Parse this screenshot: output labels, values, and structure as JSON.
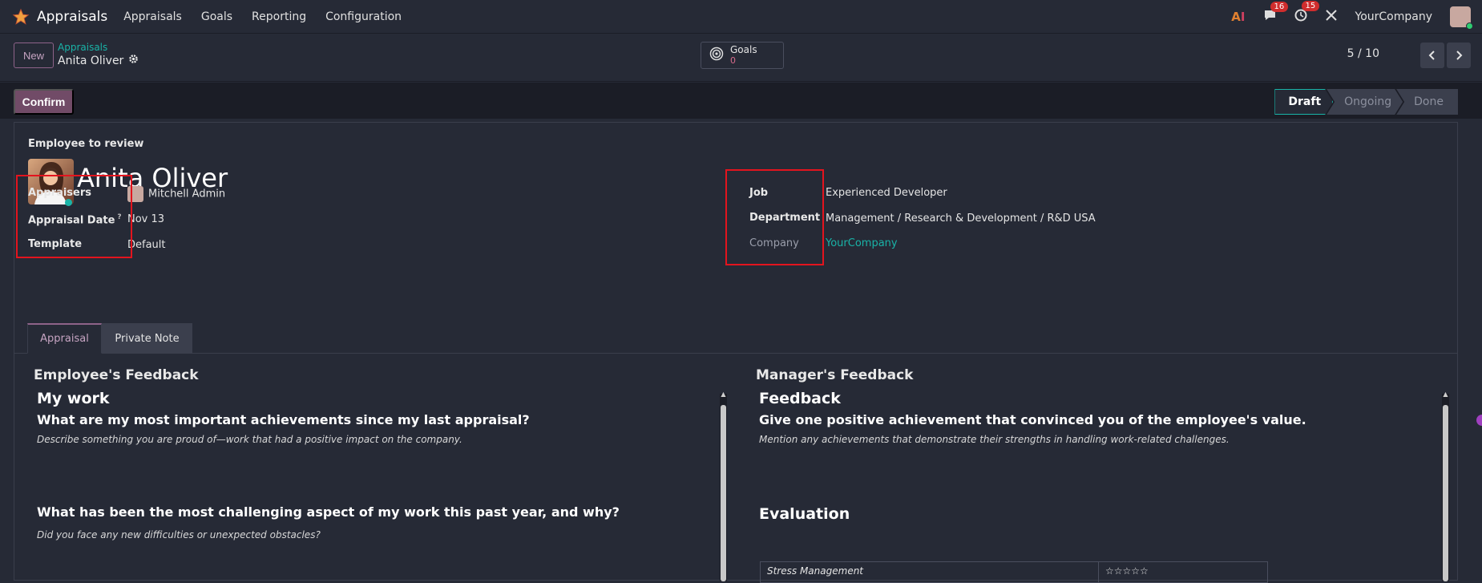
{
  "app": {
    "name": "Appraisals",
    "menu": [
      "Appraisals",
      "Goals",
      "Reporting",
      "Configuration"
    ]
  },
  "systray": {
    "messages_count": "16",
    "activities_count": "15",
    "company": "YourCompany"
  },
  "control": {
    "new_label": "New",
    "breadcrumb_parent": "Appraisals",
    "breadcrumb_current": "Anita Oliver",
    "goals_label": "Goals",
    "goals_count": "0",
    "pager": "5 / 10"
  },
  "status": {
    "confirm_label": "Confirm",
    "stages": [
      "Draft",
      "Ongoing",
      "Done"
    ],
    "active_stage": "Draft"
  },
  "employee": {
    "section_label": "Employee to review",
    "name": "Anita Oliver"
  },
  "fields_left": {
    "appraisers_label": "Appraisers",
    "appraisers_value": "Mitchell Admin",
    "date_label": "Appraisal Date",
    "date_help": "?",
    "date_value": "Nov 13",
    "template_label": "Template",
    "template_value": "Default"
  },
  "fields_right": {
    "job_label": "Job",
    "job_value": "Experienced Developer",
    "department_label": "Department",
    "department_value": "Management / Research & Development / R&D USA",
    "company_label": "Company",
    "company_value": "YourCompany"
  },
  "tabs": [
    "Appraisal",
    "Private Note"
  ],
  "employee_feedback": {
    "title": "Employee's Feedback",
    "heading": "My work",
    "q1": "What are my most important achievements since my last appraisal?",
    "q1_hint": "Describe something you are proud of—work that had a positive impact on the company.",
    "q2": "What has been the most challenging aspect of my work this past year, and why?",
    "q2_hint": "Did you face any new difficulties or unexpected obstacles?"
  },
  "manager_feedback": {
    "title": "Manager's Feedback",
    "heading": "Feedback",
    "q1": "Give one positive achievement that convinced you of the employee's value.",
    "q1_hint": "Mention any achievements that demonstrate their strengths in handling work-related challenges.",
    "evaluation_heading": "Evaluation",
    "evaluation_rows": [
      {
        "name": "Stress Management",
        "rating": "☆☆☆☆☆"
      }
    ]
  },
  "icons": {
    "logo": "star-app-icon",
    "messages": "chat-icon",
    "activities": "clock-icon",
    "settings": "tools-icon",
    "goals": "target-icon",
    "record_settings": "gear-icon"
  },
  "colors": {
    "brand": "#714b67",
    "accent": "#19b3a7",
    "highlight_box": "#e3141e"
  }
}
